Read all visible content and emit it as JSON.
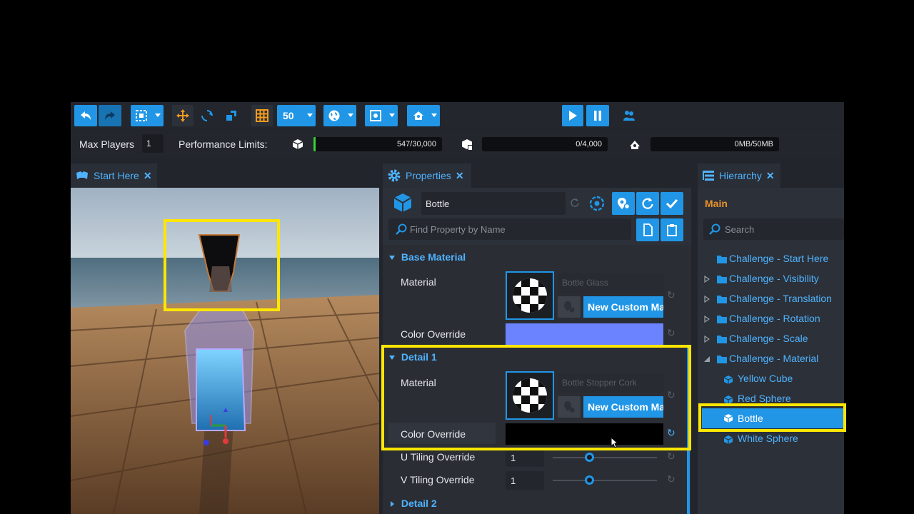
{
  "toolbar": {
    "snap_value": "50"
  },
  "stats": {
    "max_players_label": "Max Players",
    "max_players_value": "1",
    "perf_label": "Performance Limits:",
    "objects": "547/30,000",
    "networked": "0/4,000",
    "memory": "0MB/50MB",
    "objects_fraction": 0.018
  },
  "tabs": {
    "viewport": "Start Here",
    "properties": "Properties",
    "hierarchy": "Hierarchy"
  },
  "properties": {
    "object_name": "Bottle",
    "search_placeholder": "Find Property by Name",
    "base_material": {
      "title": "Base Material",
      "material_label": "Material",
      "material_name": "Bottle Glass",
      "new_custom": "New Custom Ma",
      "color_label": "Color Override",
      "color": "#6b83ff"
    },
    "detail1": {
      "title": "Detail 1",
      "material_label": "Material",
      "material_name": "Bottle Stopper Cork",
      "new_custom": "New Custom Ma",
      "color_label": "Color Override",
      "color": "#000000",
      "u_label": "U Tiling Override",
      "u_value": "1",
      "v_label": "V Tiling Override",
      "v_value": "1"
    },
    "detail2": {
      "title": "Detail 2"
    }
  },
  "hierarchy": {
    "root": "Main",
    "search_placeholder": "Search",
    "items": [
      {
        "label": "Challenge - Start Here"
      },
      {
        "label": "Challenge - Visibility"
      },
      {
        "label": "Challenge - Translation"
      },
      {
        "label": "Challenge - Rotation"
      },
      {
        "label": "Challenge - Scale"
      },
      {
        "label": "Challenge - Material"
      },
      {
        "label": "Yellow Cube"
      },
      {
        "label": "Red Sphere"
      },
      {
        "label": "Bottle"
      },
      {
        "label": "White Sphere"
      }
    ],
    "selected": "Bottle"
  },
  "colors": {
    "accent": "#2196e6",
    "highlight": "#ffe600",
    "link": "#4fb3ff",
    "main_label": "#e8922a"
  }
}
